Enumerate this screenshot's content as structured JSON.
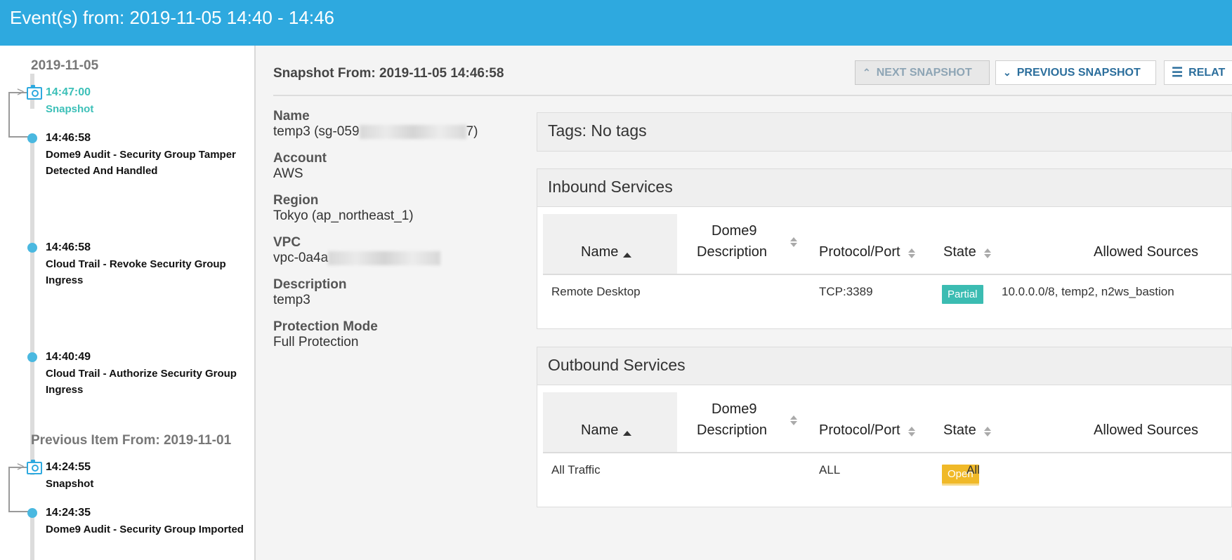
{
  "header": {
    "title": "Event(s) from: 2019-11-05 14:40 - 14:46"
  },
  "timeline": {
    "groups": [
      {
        "date": "2019-11-05",
        "events": [
          {
            "time": "14:47:00",
            "title": "Snapshot",
            "kind": "snapshot",
            "active": true
          },
          {
            "time": "14:46:58",
            "title": "Dome9 Audit - Security Group Tamper Detected And Handled",
            "kind": "event"
          },
          {
            "time": "14:46:58",
            "title": "Cloud Trail - Revoke Security Group Ingress",
            "kind": "event"
          },
          {
            "time": "14:40:49",
            "title": "Cloud Trail - Authorize Security Group Ingress",
            "kind": "event"
          }
        ]
      },
      {
        "date": "Previous Item From: 2019-11-01",
        "events": [
          {
            "time": "14:24:55",
            "title": "Snapshot",
            "kind": "snapshot",
            "active": false
          },
          {
            "time": "14:24:35",
            "title": "Dome9 Audit - Security Group Imported",
            "kind": "event"
          }
        ]
      }
    ]
  },
  "snapshot": {
    "title": "Snapshot From: 2019-11-05 14:46:58",
    "buttons": {
      "next": "NEXT SNAPSHOT",
      "previous": "PREVIOUS SNAPSHOT",
      "related": "RELAT"
    },
    "fields": [
      {
        "label": "Name",
        "value": "temp3 (sg-059",
        "value_suffix": "7)"
      },
      {
        "label": "Account",
        "value": "AWS"
      },
      {
        "label": "Region",
        "value": "Tokyo (ap_northeast_1)"
      },
      {
        "label": "VPC",
        "value": "vpc-0a4a"
      },
      {
        "label": "Description",
        "value": "temp3"
      },
      {
        "label": "Protection Mode",
        "value": "Full Protection"
      }
    ],
    "tags_text": "Tags: No tags",
    "columns": {
      "name": "Name",
      "description_line1": "Dome9",
      "description_line2": "Description",
      "protocol": "Protocol/Port",
      "state": "State",
      "sources": "Allowed Sources"
    },
    "inbound": {
      "title": "Inbound Services",
      "rows": [
        {
          "name": "Remote Desktop",
          "description": "",
          "protocol": "TCP:3389",
          "state": "Partial",
          "sources": "10.0.0.0/8, temp2, n2ws_bastion"
        }
      ]
    },
    "outbound": {
      "title": "Outbound Services",
      "rows": [
        {
          "name": "All Traffic",
          "description": "",
          "protocol": "ALL",
          "state": "Open",
          "sources": "All"
        }
      ]
    }
  },
  "colors": {
    "header": "#2ea9df",
    "accent_teal": "#3cc0b8",
    "timeline_dot": "#4ab8e0",
    "badge_partial": "#3bbcb2",
    "badge_open": "#f0b928",
    "link_blue": "#2b6e9c"
  },
  "icons": {
    "snapshot": "camera-icon",
    "event": "timeline-dot",
    "next": "chevron-up-icon",
    "previous": "chevron-down-icon",
    "related": "list-icon",
    "sort": "sort-icon",
    "sort_asc": "sort-asc-icon"
  }
}
